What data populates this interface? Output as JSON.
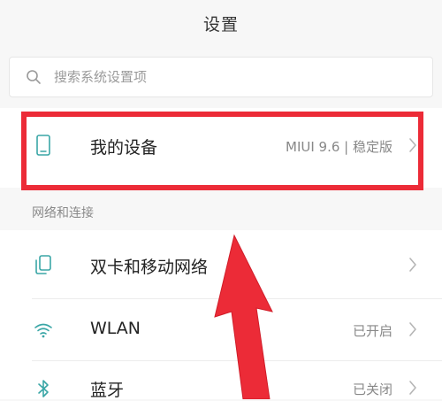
{
  "header": {
    "title": "设置"
  },
  "search": {
    "placeholder": "搜索系统设置项"
  },
  "device": {
    "label": "我的设备",
    "value": "MIUI 9.6 | 稳定版"
  },
  "network_section": {
    "title": "网络和连接",
    "items": [
      {
        "label": "双卡和移动网络",
        "value": "",
        "icon": "sim-card-icon"
      },
      {
        "label": "WLAN",
        "value": "已开启",
        "icon": "wifi-icon"
      },
      {
        "label": "蓝牙",
        "value": "已关闭",
        "icon": "bluetooth-icon"
      }
    ]
  },
  "colors": {
    "accent_teal": "#3aa6a6",
    "highlight_red": "#ec2b37",
    "background": "#f7f7f7"
  }
}
